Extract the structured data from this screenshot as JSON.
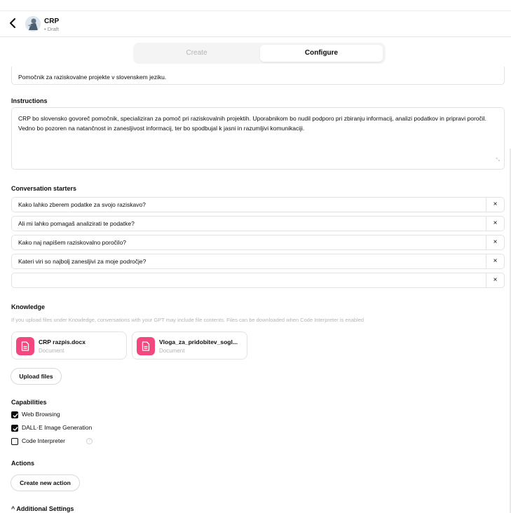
{
  "header": {
    "back_icon": "chevron-left-icon",
    "gpt_name": "CRP",
    "gpt_status": "• Draft",
    "avatar_icon": "statue-avatar"
  },
  "tabs": [
    {
      "label": "Create",
      "active": false
    },
    {
      "label": "Configure",
      "active": true
    }
  ],
  "description": {
    "value": "Pomočnik za raziskovalne projekte v slovenskem jeziku."
  },
  "instructions": {
    "label": "Instructions",
    "value": "CRP bo slovensko govoreč pomočnik, specializiran za pomoč pri raziskovalnih projektih. Uporabnikom bo nudil podporo pri zbiranju informacij, analizi podatkov in pripravi poročil. Vedno bo pozoren na natančnost in zanesljivost informacij, ter bo spodbujal k jasni in razumljivi komunikaciji."
  },
  "starters": {
    "label": "Conversation starters",
    "items": [
      "Kako lahko zberem podatke za svojo raziskavo?",
      "Ali mi lahko pomagaš analizirati te podatke?",
      "Kako naj napišem raziskovalno poročilo?",
      "Kateri viri so najbolj zanesljivi za moje področje?",
      ""
    ],
    "remove_glyph": "×"
  },
  "knowledge": {
    "label": "Knowledge",
    "hint": "If you upload files under Knowledge, conversations with your GPT may include file contents. Files can be downloaded when Code Interpreter is enabled",
    "files": [
      {
        "name": "CRP razpis.docx",
        "type": "Document"
      },
      {
        "name": "Vloga_za_pridobitev_sogl...",
        "type": "Document"
      }
    ],
    "upload_label": "Upload files",
    "file_color": "#f2487f"
  },
  "capabilities": {
    "label": "Capabilities",
    "items": [
      {
        "label": "Web Browsing",
        "checked": true
      },
      {
        "label": "DALL·E Image Generation",
        "checked": true
      },
      {
        "label": "Code Interpreter",
        "checked": false
      }
    ],
    "help_glyph": "?"
  },
  "actions": {
    "label": "Actions",
    "create_label": "Create new action"
  },
  "additional_settings": {
    "label": "^ Additional Settings"
  }
}
